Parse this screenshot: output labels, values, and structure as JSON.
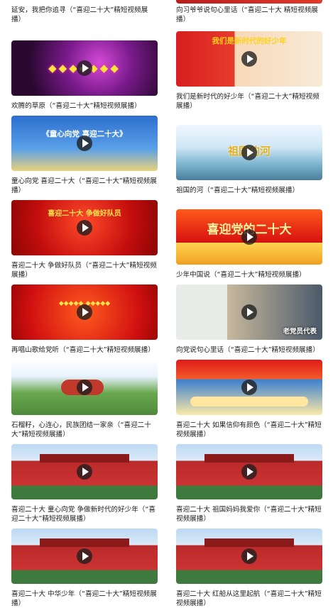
{
  "left": [
    {
      "title": "延安，我把你追寻（“喜迎二十大”精短视频展播）",
      "overlay": "",
      "bg": "none"
    },
    {
      "title": "欢腾的草原（“喜迎二十大”精短视频展播）",
      "overlay": "",
      "bg": "grass"
    },
    {
      "title": "童心向党 喜迎二十大（“喜迎二十大”精短视频展播）",
      "overlay": "《童心向党 喜迎二十大》",
      "bg": "tongxin"
    },
    {
      "title": "喜迎二十大 争做好队员（“喜迎二十大”精短视频展播）",
      "overlay": "喜迎二十大 争做好队员",
      "bg": "zuoduiyuan"
    },
    {
      "title": "再唱山歌给党听（“喜迎二十大”精短视频展播）",
      "overlay": "",
      "bg": "chang"
    },
    {
      "title": "石榴籽，心连心，民族团结一家亲（“喜迎二十大”精短视频展播）",
      "overlay": "",
      "bg": "shiliu"
    },
    {
      "title": "喜迎二十大 童心向党 争做新时代的好少年（“喜迎二十大”精短视频展播）",
      "overlay": "",
      "bg": "tiananmen"
    },
    {
      "title": "喜迎二十大 中华少年（“喜迎二十大”精短视频展播）",
      "overlay": "",
      "bg": "tiananmen"
    }
  ],
  "right": [
    {
      "title": "向习爷爷说句心里话（“喜迎二十大 精短视频展播）",
      "overlay": "",
      "bg": "none"
    },
    {
      "title": "我们是新时代的好少年（“喜迎二十大”精短视频展播）",
      "overlay": "我们是新时代的好少年",
      "bg": "hao"
    },
    {
      "title": "祖国的河（“喜迎二十大”精短视频展播）",
      "overlay": "祖国的河",
      "bg": "he"
    },
    {
      "title": "少年中国说（“喜迎二十大”精短视频展播）",
      "overlay": "喜迎党的二十大",
      "bg": "shaonian"
    },
    {
      "title": "向党说句心里话（“喜迎二十大”精短视频展播）",
      "overlay": "老党员代表",
      "bg": "xiang"
    },
    {
      "title": "喜迎二十大 如果信仰有颜色（“喜迎二十大”精短视频展播）",
      "overlay": "",
      "bg": "xinyang"
    },
    {
      "title": "喜迎二十大 祖国妈妈我爱你（“喜迎二十大”精短视频展播）",
      "overlay": "",
      "bg": "tiananmen"
    },
    {
      "title": "喜迎二十大 红船从这里起航（“喜迎二十大”精短视频展播）",
      "overlay": "",
      "bg": "tiananmen"
    }
  ]
}
